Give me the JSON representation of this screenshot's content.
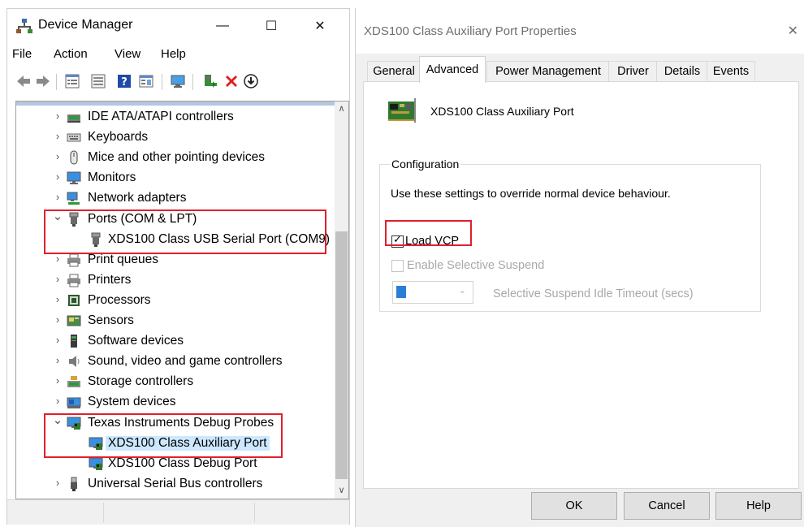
{
  "device_manager": {
    "title": "Device Manager",
    "window_buttons": {
      "minimize": "—",
      "maximize": "☐",
      "close": "✕"
    },
    "menu": [
      "File",
      "Action",
      "View",
      "Help"
    ],
    "tree": [
      {
        "label": "IDE ATA/ATAPI controllers",
        "chevron": "›",
        "icon": "ide-controller-icon"
      },
      {
        "label": "Keyboards",
        "chevron": "›",
        "icon": "keyboard-icon"
      },
      {
        "label": "Mice and other pointing devices",
        "chevron": "›",
        "icon": "mouse-icon"
      },
      {
        "label": "Monitors",
        "chevron": "›",
        "icon": "monitor-icon"
      },
      {
        "label": "Network adapters",
        "chevron": "›",
        "icon": "network-adapter-icon"
      },
      {
        "label": "Ports (COM & LPT)",
        "chevron": "⌄",
        "icon": "port-icon"
      },
      {
        "label": "XDS100 Class USB Serial Port (COM9)",
        "chevron": "",
        "icon": "port-icon"
      },
      {
        "label": "Print queues",
        "chevron": "›",
        "icon": "printer-icon"
      },
      {
        "label": "Printers",
        "chevron": "›",
        "icon": "printer-icon"
      },
      {
        "label": "Processors",
        "chevron": "›",
        "icon": "processor-icon"
      },
      {
        "label": "Sensors",
        "chevron": "›",
        "icon": "sensor-icon"
      },
      {
        "label": "Software devices",
        "chevron": "›",
        "icon": "software-device-icon"
      },
      {
        "label": "Sound, video and game controllers",
        "chevron": "›",
        "icon": "speaker-icon"
      },
      {
        "label": "Storage controllers",
        "chevron": "›",
        "icon": "storage-controller-icon"
      },
      {
        "label": "System devices",
        "chevron": "›",
        "icon": "system-devices-icon"
      },
      {
        "label": "Texas Instruments Debug Probes",
        "chevron": "⌄",
        "icon": "debug-probe-icon"
      },
      {
        "label": "XDS100 Class Auxiliary Port",
        "chevron": "",
        "icon": "debug-probe-icon"
      },
      {
        "label": "XDS100 Class Debug Port",
        "chevron": "",
        "icon": "debug-probe-icon"
      },
      {
        "label": "Universal Serial Bus controllers",
        "chevron": "›",
        "icon": "usb-icon"
      }
    ],
    "selected_item": "XDS100 Class Auxiliary Port"
  },
  "properties": {
    "title": "XDS100 Class Auxiliary Port Properties",
    "close": "✕",
    "tabs": [
      "General",
      "Advanced",
      "Power Management",
      "Driver",
      "Details",
      "Events"
    ],
    "active_tab": "Advanced",
    "device_name": "XDS100 Class Auxiliary Port",
    "group_title": "Configuration",
    "description": "Use these settings to override normal device behaviour.",
    "load_vcp": {
      "label": "Load VCP",
      "checked": "✓"
    },
    "selective_suspend": {
      "label": "Enable Selective Suspend"
    },
    "idle_timeout": {
      "label": "Selective Suspend Idle Timeout (secs)",
      "arrow": "⌄"
    },
    "buttons": {
      "ok": "OK",
      "cancel": "Cancel",
      "help": "Help"
    }
  },
  "colors": {
    "highlight_box": "#e0202c",
    "selection": "#cce8ff",
    "accent_blue": "#2a7fd4"
  }
}
